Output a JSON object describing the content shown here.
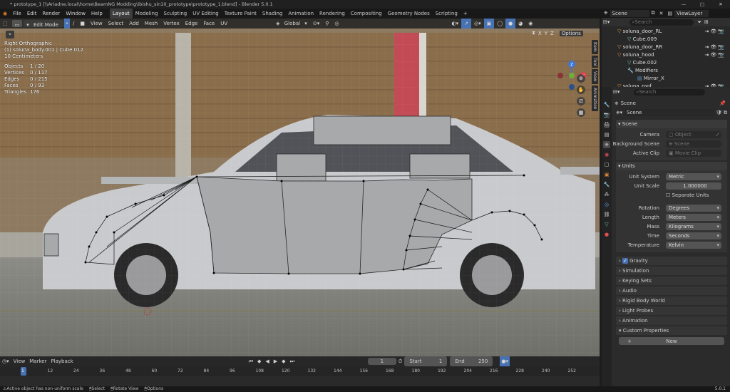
{
  "window": {
    "title": "* prototype_1 [\\\\Ariadne.local\\home\\BeamNG Modding\\ibishu_sin10_prototype\\prototype_1.blend] - Blender 5.0.1",
    "controls": [
      "—",
      "□",
      "✕"
    ]
  },
  "menus": [
    "File",
    "Edit",
    "Render",
    "Window",
    "Help"
  ],
  "workspaces": [
    "Layout",
    "Modeling",
    "Sculpting",
    "UV Editing",
    "Texture Paint",
    "Shading",
    "Animation",
    "Rendering",
    "Compositing",
    "Geometry Nodes",
    "Scripting"
  ],
  "workspace_add": "+",
  "scene_selector": {
    "label": "Scene",
    "view_layer": "ViewLayer"
  },
  "viewport": {
    "mode": "Edit Mode",
    "menu": [
      "View",
      "Select",
      "Add",
      "Mesh",
      "Vertex",
      "Edge",
      "Face",
      "UV"
    ],
    "transform_orientation": "Global",
    "axes": [
      "X",
      "Y",
      "Z"
    ],
    "options_label": "Options",
    "view_name": "Right Orthographic",
    "object_line": "(1) soluna_body.001 | Cube.012",
    "scale_line": "10 Centimeters",
    "stats": [
      {
        "k": "Objects",
        "v": "1 / 20"
      },
      {
        "k": "Vertices",
        "v": "0 / 117"
      },
      {
        "k": "Edges",
        "v": "0 / 215"
      },
      {
        "k": "Faces",
        "v": "0 / 93"
      },
      {
        "k": "Triangles",
        "v": "176"
      }
    ],
    "sidebar_tabs": [
      "Item",
      "Tool",
      "View",
      "Animation"
    ],
    "gizmo": {
      "x": "X",
      "y": "Y",
      "z": "Z"
    }
  },
  "outliner": {
    "search_placeholder": "Search",
    "rows": [
      {
        "name": "soluna_door_RL",
        "indent": 1
      },
      {
        "name": "Cube.009",
        "indent": 2
      },
      {
        "name": "soluna_door_RR",
        "indent": 1
      },
      {
        "name": "soluna_hood",
        "indent": 1
      },
      {
        "name": "Cube.002",
        "indent": 2
      },
      {
        "name": "Modifiers",
        "indent": 2
      },
      {
        "name": "Mirror_X",
        "indent": 3
      },
      {
        "name": "soluna_roof",
        "indent": 1
      }
    ]
  },
  "properties": {
    "search_placeholder": "Search",
    "breadcrumb": "Scene",
    "scene_name": "Scene",
    "scene_panel": {
      "title": "Scene",
      "camera_label": "Camera",
      "camera_placeholder": "Object",
      "background_label": "Background Scene",
      "background_placeholder": "Scene",
      "clip_label": "Active Clip",
      "clip_placeholder": "Movie Clip"
    },
    "units_panel": {
      "title": "Units",
      "unit_system_label": "Unit System",
      "unit_system": "Metric",
      "unit_scale_label": "Unit Scale",
      "unit_scale": "1.000000",
      "separate_units_label": "Separate Units",
      "rotation_label": "Rotation",
      "rotation": "Degrees",
      "length_label": "Length",
      "length": "Meters",
      "mass_label": "Mass",
      "mass": "Kilograms",
      "time_label": "Time",
      "time": "Seconds",
      "temperature_label": "Temperature",
      "temperature": "Kelvin"
    },
    "collapsed": [
      "Gravity",
      "Simulation",
      "Keying Sets",
      "Audio",
      "Rigid Body World",
      "Light Probes",
      "Animation",
      "Custom Properties"
    ],
    "new_button": "New"
  },
  "timeline": {
    "menu": [
      "View",
      "Marker",
      "Playback"
    ],
    "current_frame": "1",
    "start_label": "Start",
    "start": "1",
    "end_label": "End",
    "end": "250",
    "ticks": [
      "1",
      "12",
      "24",
      "36",
      "48",
      "60",
      "72",
      "84",
      "96",
      "108",
      "120",
      "132",
      "144",
      "156",
      "168",
      "180",
      "192",
      "204",
      "216",
      "228",
      "240",
      "252"
    ]
  },
  "statusbar": {
    "message": "Active object has non-uniform scale",
    "hints": [
      "Select",
      "Rotate View",
      "Options"
    ],
    "version": "5.0.1"
  },
  "colors": {
    "accent": "#4772b3",
    "active_ws": "#3d3d3d",
    "mesh_face": "#a8a9ab"
  }
}
